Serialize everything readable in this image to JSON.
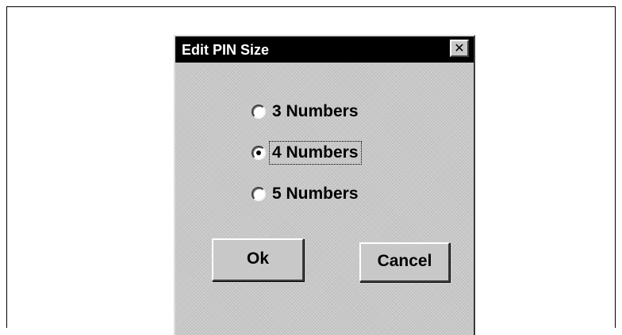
{
  "dialog": {
    "title": "Edit PIN Size",
    "close_label": "✕",
    "options": [
      {
        "label": "3 Numbers",
        "selected": false
      },
      {
        "label": "4 Numbers",
        "selected": true
      },
      {
        "label": "5 Numbers",
        "selected": false
      }
    ],
    "ok_label": "Ok",
    "cancel_label": "Cancel"
  },
  "icons": {
    "close": "close-icon",
    "radio_selected": "radio-selected-icon",
    "radio_unselected": "radio-unselected-icon"
  },
  "colors": {
    "titlebar": "#000000",
    "title_text": "#ffffff",
    "dialog_face": "#c8c8c8"
  }
}
